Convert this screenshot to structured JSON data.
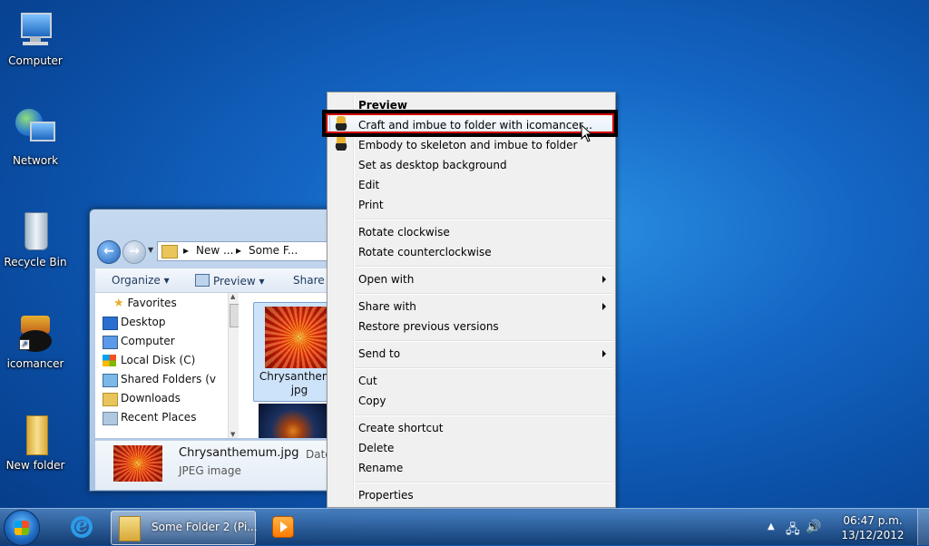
{
  "desktop": {
    "icons": [
      {
        "label": "Computer"
      },
      {
        "label": "Network"
      },
      {
        "label": "Recycle Bin"
      },
      {
        "label": "icomancer"
      },
      {
        "label": "New folder"
      }
    ]
  },
  "explorer": {
    "address": {
      "crumb1": "New ...",
      "crumb2": "Some F..."
    },
    "toolbar": {
      "organize": "Organize",
      "preview": "Preview",
      "share": "Share w"
    },
    "nav": {
      "favorites": "Favorites",
      "items": [
        "Desktop",
        "Computer",
        "Local Disk (C)",
        "Shared Folders (v",
        "Downloads",
        "Recent Places"
      ]
    },
    "file": {
      "name_line1": "Chrysanthemu",
      "name_line2": "jpg"
    },
    "details": {
      "name": "Chrysanthemum.jpg",
      "type": "JPEG image",
      "date_label": "Date tak"
    }
  },
  "context_menu": {
    "items": [
      {
        "label": "Preview",
        "bold": true
      },
      {
        "label": "Craft and imbue to folder with icomancer...",
        "highlighted": true,
        "icon": "icomancer-icon"
      },
      {
        "label": "Embody to skeleton and imbue to folder",
        "icon": "icomancer-icon"
      },
      {
        "label": "Set as desktop background"
      },
      {
        "label": "Edit"
      },
      {
        "label": "Print"
      },
      {
        "label": "Rotate clockwise"
      },
      {
        "label": "Rotate counterclockwise"
      },
      {
        "label": "Open with",
        "submenu": true
      },
      {
        "label": "Share with",
        "submenu": true
      },
      {
        "label": "Restore previous versions"
      },
      {
        "label": "Send to",
        "submenu": true
      },
      {
        "label": "Cut"
      },
      {
        "label": "Copy"
      },
      {
        "label": "Create shortcut"
      },
      {
        "label": "Delete"
      },
      {
        "label": "Rename"
      },
      {
        "label": "Properties"
      }
    ]
  },
  "taskbar": {
    "folder_button": "Some Folder 2 (Pi...",
    "clock": {
      "time": "06:47 p.m.",
      "date": "13/12/2012"
    }
  },
  "colors": {
    "highlight_box": "#d00000",
    "desktop_blue": "#1466c4"
  }
}
